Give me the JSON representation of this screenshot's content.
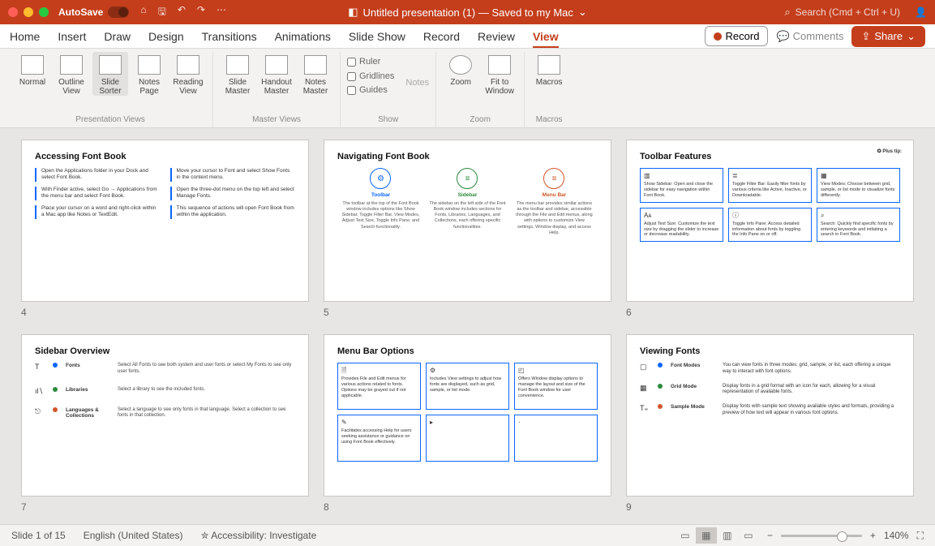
{
  "titlebar": {
    "autosave": "AutoSave",
    "doc_title": "Untitled presentation (1) — Saved to my Mac",
    "search": "Search (Cmd + Ctrl + U)"
  },
  "tabs": {
    "items": [
      "Home",
      "Insert",
      "Draw",
      "Design",
      "Transitions",
      "Animations",
      "Slide Show",
      "Record",
      "Review",
      "View"
    ],
    "record": "Record",
    "comments": "Comments",
    "share": "Share"
  },
  "ribbon": {
    "presentation_views": {
      "label": "Presentation Views",
      "items": [
        "Normal",
        "Outline View",
        "Slide Sorter",
        "Notes Page",
        "Reading View"
      ]
    },
    "master_views": {
      "label": "Master Views",
      "items": [
        "Slide Master",
        "Handout Master",
        "Notes Master"
      ]
    },
    "show": {
      "label": "Show",
      "checks": [
        "Ruler",
        "Gridlines",
        "Guides"
      ],
      "notes": "Notes"
    },
    "zoom": {
      "label": "Zoom",
      "items": [
        "Zoom",
        "Fit to Window"
      ]
    },
    "macros": {
      "label": "Macros",
      "items": [
        "Macros"
      ]
    }
  },
  "slides": {
    "s4": {
      "num": "4",
      "title": "Accessing Font Book",
      "items": [
        "Open the Applications folder in your Dock and select Font Book.",
        "Move your cursor to Font and select Show Fonts in the context menu.",
        "With Finder active, select Go → Applications from the menu bar and select Font Book.",
        "Open the three-dot menu on the top left and select Manage Fonts.",
        "Place your cursor on a word and right-click within a Mac app like Notes or TextEdit.",
        "This sequence of actions will open Font Book from within the application."
      ]
    },
    "s5": {
      "num": "5",
      "title": "Navigating Font Book",
      "cols": [
        {
          "label": "Toolbar",
          "color": "#0b66ff",
          "glyph": "⚙",
          "text": "The toolbar at the top of the Font Book window includes options like Show Sidebar, Toggle Filter Bar, View Modes, Adjust Text Size, Toggle Info Pane, and Search functionality."
        },
        {
          "label": "Sidebar",
          "color": "#2a8a3a",
          "glyph": "≡",
          "text": "The sidebar on the left side of the Font Book window includes sections for Fonts, Libraries, Languages, and Collections, each offering specific functionalities."
        },
        {
          "label": "Menu Bar",
          "color": "#d1572a",
          "glyph": "≡",
          "text": "The menu bar provides similar actions as the toolbar and sidebar, accessible through the File and Edit menus, along with options to customize View settings, Window display, and access Help."
        }
      ]
    },
    "s6": {
      "num": "6",
      "title": "Toolbar Features",
      "tip": "✪ Plus tip:",
      "cells": [
        {
          "ico": "▥",
          "text": "Show Sidebar: Open and close the sidebar for easy navigation within Font Book."
        },
        {
          "ico": "≣",
          "text": "Toggle Filter Bar: Easily filter fonts by various criteria like Active, Inactive, or Downloadable."
        },
        {
          "ico": "▦",
          "text": "View Modes: Choose between grid, sample, or list mode to visualize fonts differently."
        },
        {
          "ico": "Aᴀ",
          "text": "Adjust Text Size: Customize the text size by dragging the slider to increase or decrease readability."
        },
        {
          "ico": "ⓘ",
          "text": "Toggle Info Pane: Access detailed information about fonts by toggling the Info Pane on or off."
        },
        {
          "ico": "⌕",
          "text": "Search: Quickly find specific fonts by entering keywords and initiating a search in Font Book."
        }
      ]
    },
    "s7": {
      "num": "7",
      "title": "Sidebar Overview",
      "rows": [
        {
          "ico": "T",
          "dot": "#0b66ff",
          "label": "Fonts",
          "text": "Select All Fonts to see both system and user fonts or select My Fonts to see only user fonts."
        },
        {
          "ico": "ıl∖",
          "dot": "#2a8a3a",
          "label": "Libraries",
          "text": "Select a library to see the included fonts."
        },
        {
          "ico": "⎋",
          "dot": "#d1572a",
          "label": "Languages & Collections",
          "text": "Select a language to see only fonts in that language. Select a collection to see fonts in that collection."
        }
      ]
    },
    "s8": {
      "num": "8",
      "title": "Menu Bar Options",
      "cells": [
        {
          "ico": "🗎",
          "text": "Provides File and Edit menus for various actions related to fonts. Options may be grayed out if not applicable."
        },
        {
          "ico": "⚙",
          "text": "Includes View settings to adjust how fonts are displayed, such as grid, sample, or list mode."
        },
        {
          "ico": "◰",
          "text": "Offers Window display options to manage the layout and size of the Font Book window for user convenience."
        },
        {
          "ico": "✎",
          "text": "Facilitates accessing Help for users seeking assistance or guidance on using Font Book effectively."
        },
        {
          "ico": "▸",
          "text": ""
        },
        {
          "ico": "·",
          "text": ""
        }
      ]
    },
    "s9": {
      "num": "9",
      "title": "Viewing Fonts",
      "rows": [
        {
          "ico": "▢",
          "dot": "#0b66ff",
          "label": "Font Modes",
          "text": "You can view fonts in three modes: grid, sample, or list, each offering a unique way to interact with font options."
        },
        {
          "ico": "▦",
          "dot": "#2a8a3a",
          "label": "Grid Mode",
          "text": "Display fonts in a grid format with an icon for each, allowing for a visual representation of available fonts."
        },
        {
          "ico": "T₌",
          "dot": "#d1572a",
          "label": "Sample Mode",
          "text": "Display fonts with sample text showing available styles and formats, providing a preview of how text will appear in various font options."
        }
      ]
    }
  },
  "status": {
    "slide": "Slide 1 of 15",
    "lang": "English (United States)",
    "a11y": "Accessibility: Investigate",
    "zoom": "140%"
  }
}
